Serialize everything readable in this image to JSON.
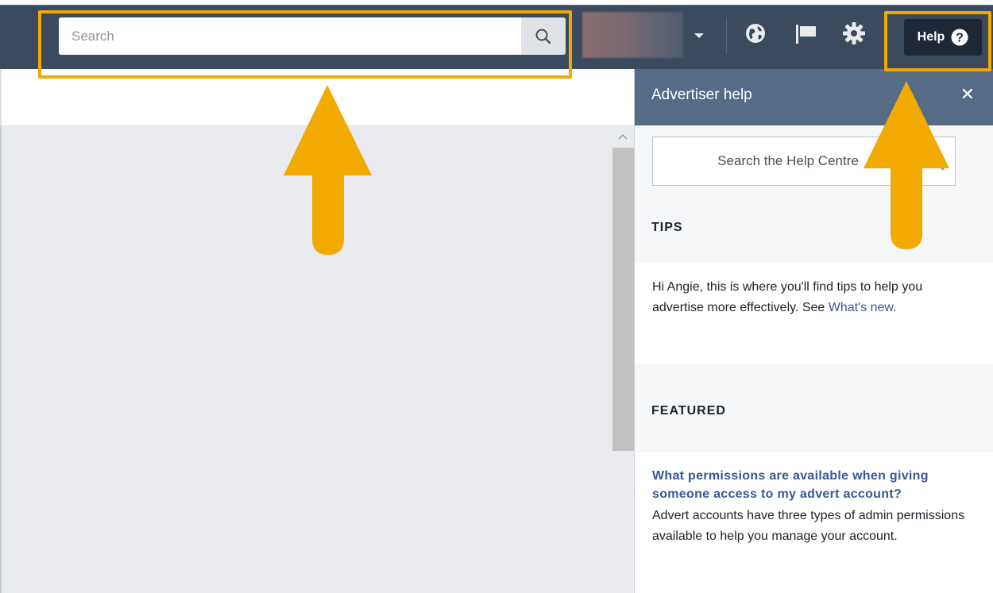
{
  "topbar": {
    "search_placeholder": "Search",
    "search_icon": "magnifier-icon",
    "account_dropdown_icon": "caret-down-icon",
    "icons": [
      "globe-icon",
      "flag-icon",
      "gear-icon"
    ],
    "help_label": "Help",
    "help_icon": "question-circle-icon"
  },
  "help_panel": {
    "title": "Advertiser help",
    "close_icon": "close-icon",
    "search_placeholder": "Search the Help Centre",
    "tips": {
      "heading": "TIPS",
      "text": "Hi Angie, this is where you'll find tips to help you advertise more effectively. See ",
      "link": "What's new",
      "after_link": "."
    },
    "featured": {
      "heading": "FEATURED",
      "article_title": "What permissions are available when giving someone access to my advert account?",
      "article_body": "Advert accounts have three types of admin permissions available to help you manage your account."
    }
  },
  "colors": {
    "topbar": "#3b4a5c",
    "panel_header": "#566b85",
    "link": "#365899",
    "highlight": "#f2a900"
  }
}
